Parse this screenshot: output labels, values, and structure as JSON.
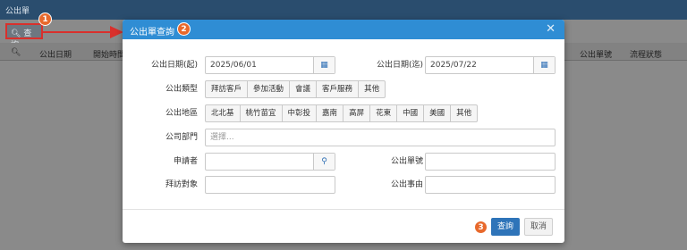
{
  "app": {
    "title": "公出單"
  },
  "toolbar": {
    "search_label": "查詢"
  },
  "table": {
    "headers_left": [
      "公出日期",
      "開始時間"
    ],
    "headers_right": [
      "公出單號",
      "流程狀態"
    ]
  },
  "markers": [
    "1",
    "2",
    "3"
  ],
  "modal": {
    "title": "公出單查詢",
    "date_start": {
      "label": "公出日期(起)",
      "value": "2025/06/01"
    },
    "date_end": {
      "label": "公出日期(迄)",
      "value": "2025/07/22"
    },
    "type": {
      "label": "公出類型",
      "options": [
        "拜訪客戶",
        "參加活動",
        "會議",
        "客戶服務",
        "其他"
      ]
    },
    "region": {
      "label": "公出地區",
      "options": [
        "北北基",
        "桃竹苗宜",
        "中彰投",
        "嘉南",
        "高屏",
        "花東",
        "中國",
        "美國",
        "其他"
      ]
    },
    "dept": {
      "label": "公司部門",
      "placeholder": "選擇..."
    },
    "applicant": {
      "label": "申請者",
      "value": ""
    },
    "form_no": {
      "label": "公出單號",
      "value": ""
    },
    "visit_target": {
      "label": "拜訪對象",
      "value": ""
    },
    "reason": {
      "label": "公出事由",
      "value": ""
    },
    "query_button": "查詢",
    "cancel_button": "取消"
  },
  "colors": {
    "header_bg": "#2f8dd4",
    "primary": "#2e74b9",
    "marker": "#e8692c",
    "highlight": "#d9302c"
  },
  "icons": {
    "close": "close-icon",
    "calendar": "calendar-icon",
    "search": "search-icon"
  }
}
